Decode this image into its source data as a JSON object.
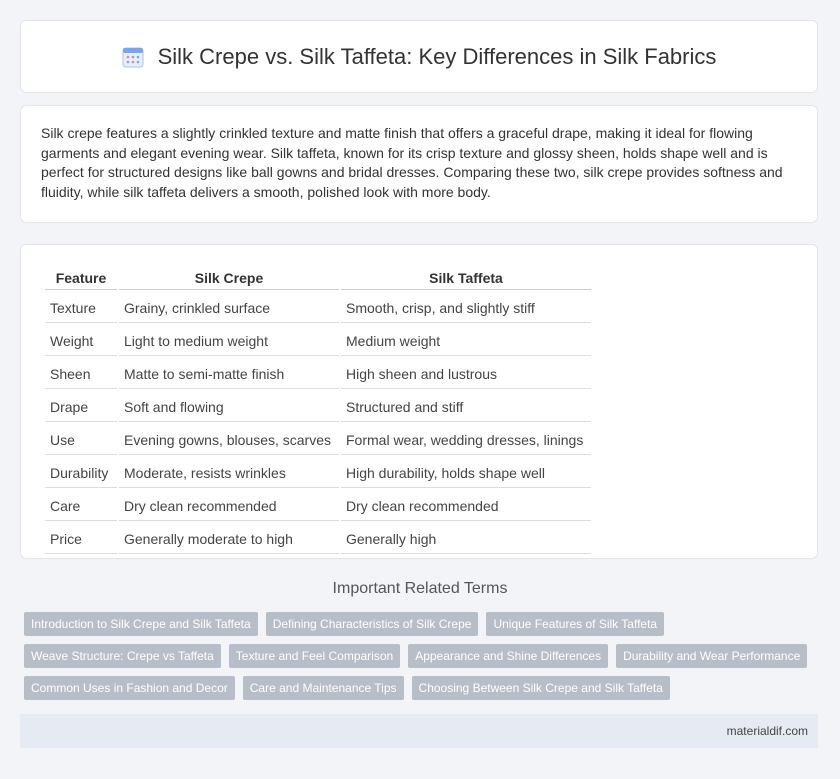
{
  "header": {
    "title": "Silk Crepe vs. Silk Taffeta: Key Differences in Silk Fabrics",
    "icon": "calendar-grid-icon"
  },
  "intro": {
    "text": "Silk crepe features a slightly crinkled texture and matte finish that offers a graceful drape, making it ideal for flowing garments and elegant evening wear. Silk taffeta, known for its crisp texture and glossy sheen, holds shape well and is perfect for structured designs like ball gowns and bridal dresses. Comparing these two, silk crepe provides softness and fluidity, while silk taffeta delivers a smooth, polished look with more body."
  },
  "table": {
    "headers": [
      "Feature",
      "Silk Crepe",
      "Silk Taffeta"
    ],
    "rows": [
      [
        "Texture",
        "Grainy, crinkled surface",
        "Smooth, crisp, and slightly stiff"
      ],
      [
        "Weight",
        "Light to medium weight",
        "Medium weight"
      ],
      [
        "Sheen",
        "Matte to semi-matte finish",
        "High sheen and lustrous"
      ],
      [
        "Drape",
        "Soft and flowing",
        "Structured and stiff"
      ],
      [
        "Use",
        "Evening gowns, blouses, scarves",
        "Formal wear, wedding dresses, linings"
      ],
      [
        "Durability",
        "Moderate, resists wrinkles",
        "High durability, holds shape well"
      ],
      [
        "Care",
        "Dry clean recommended",
        "Dry clean recommended"
      ],
      [
        "Price",
        "Generally moderate to high",
        "Generally high"
      ]
    ]
  },
  "related": {
    "title": "Important Related Terms",
    "rows": [
      [
        "Introduction to Silk Crepe and Silk Taffeta",
        "Defining Characteristics of Silk Crepe",
        "Unique Features of Silk Taffeta"
      ],
      [
        "Weave Structure: Crepe vs Taffeta",
        "Texture and Feel Comparison",
        "Appearance and Shine Differences",
        "Durability and Wear Performance"
      ],
      [
        "Common Uses in Fashion and Decor",
        "Care and Maintenance Tips",
        "Choosing Between Silk Crepe and Silk Taffeta"
      ]
    ]
  },
  "footer": {
    "site": "materialdif.com"
  },
  "colors": {
    "tag_bg": "#b8bec7",
    "footer_bg": "#e6eaf3",
    "icon_blue": "#6f9be8",
    "icon_pink": "#f07ea8"
  }
}
